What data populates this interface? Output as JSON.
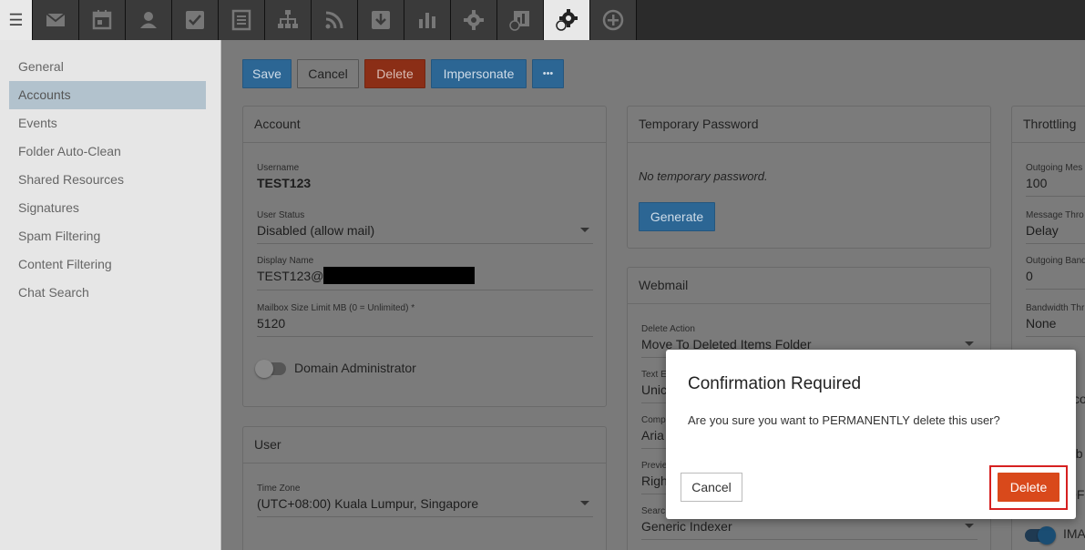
{
  "topbar": {
    "menu_icon": "hamburger-icon",
    "tools": [
      {
        "icon": "mail-icon"
      },
      {
        "icon": "calendar-icon"
      },
      {
        "icon": "contacts-icon"
      },
      {
        "icon": "tasks-icon"
      },
      {
        "icon": "notes-icon"
      },
      {
        "icon": "sitemap-icon"
      },
      {
        "icon": "rss-icon"
      },
      {
        "icon": "file-storage-icon"
      },
      {
        "icon": "reports-icon"
      },
      {
        "icon": "settings-gear-icon"
      },
      {
        "icon": "domain-reports-icon"
      },
      {
        "icon": "domain-settings-icon"
      },
      {
        "icon": "add-circle-icon"
      }
    ]
  },
  "sidebar": {
    "items": [
      {
        "label": "General"
      },
      {
        "label": "Accounts"
      },
      {
        "label": "Events"
      },
      {
        "label": "Folder Auto-Clean"
      },
      {
        "label": "Shared Resources"
      },
      {
        "label": "Signatures"
      },
      {
        "label": "Spam Filtering"
      },
      {
        "label": "Content Filtering"
      },
      {
        "label": "Chat Search"
      }
    ],
    "active_index": 1
  },
  "toolbar": {
    "save_label": "Save",
    "cancel_label": "Cancel",
    "delete_label": "Delete",
    "impersonate_label": "Impersonate",
    "more_label": "•••"
  },
  "account_card": {
    "title": "Account",
    "username_label": "Username",
    "username_value": "TEST123",
    "status_label": "User Status",
    "status_value": "Disabled (allow mail)",
    "display_name_label": "Display Name",
    "display_name_value": "TEST123@",
    "mailbox_label": "Mailbox Size Limit MB (0 = Unlimited) *",
    "mailbox_value": "5120",
    "domain_admin_label": "Domain Administrator"
  },
  "user_card": {
    "title": "User",
    "timezone_label": "Time Zone",
    "timezone_value": "(UTC+08:00) Kuala Lumpur, Singapore"
  },
  "temp_password_card": {
    "title": "Temporary Password",
    "message": "No temporary password.",
    "generate_label": "Generate"
  },
  "webmail_card": {
    "title": "Webmail",
    "delete_action_label": "Delete Action",
    "delete_action_value": "Move To Deleted Items Folder",
    "text_label": "Text E",
    "text_value": "Unic",
    "comp_label": "Comp",
    "comp_value": "Aria",
    "preview_label": "Previe",
    "preview_value": "Righ",
    "search_label": "Searc",
    "search_value": "Generic Indexer"
  },
  "throttling_card": {
    "title": "Throttling",
    "outgoing_msg_label": "Outgoing Mes",
    "outgoing_msg_value": "100",
    "message_throttle_label": "Message Thro",
    "message_throttle_value": "Delay",
    "outgoing_bandwidth_label": "Outgoing Band",
    "outgoing_bandwidth_value": "0",
    "bandwidth_throttle_label": "Bandwidth Thr",
    "bandwidth_throttle_value": "None",
    "partial_1": "cco",
    "partial_2": "eb",
    "partial_3": "OF",
    "imap_label": "IMA"
  },
  "modal": {
    "title": "Confirmation Required",
    "message": "Are you sure you want to PERMANENTLY delete this user?",
    "cancel_label": "Cancel",
    "delete_label": "Delete"
  },
  "colors": {
    "primary": "#337ab7",
    "danger": "#d9491b",
    "highlight_ring": "#d62020"
  }
}
